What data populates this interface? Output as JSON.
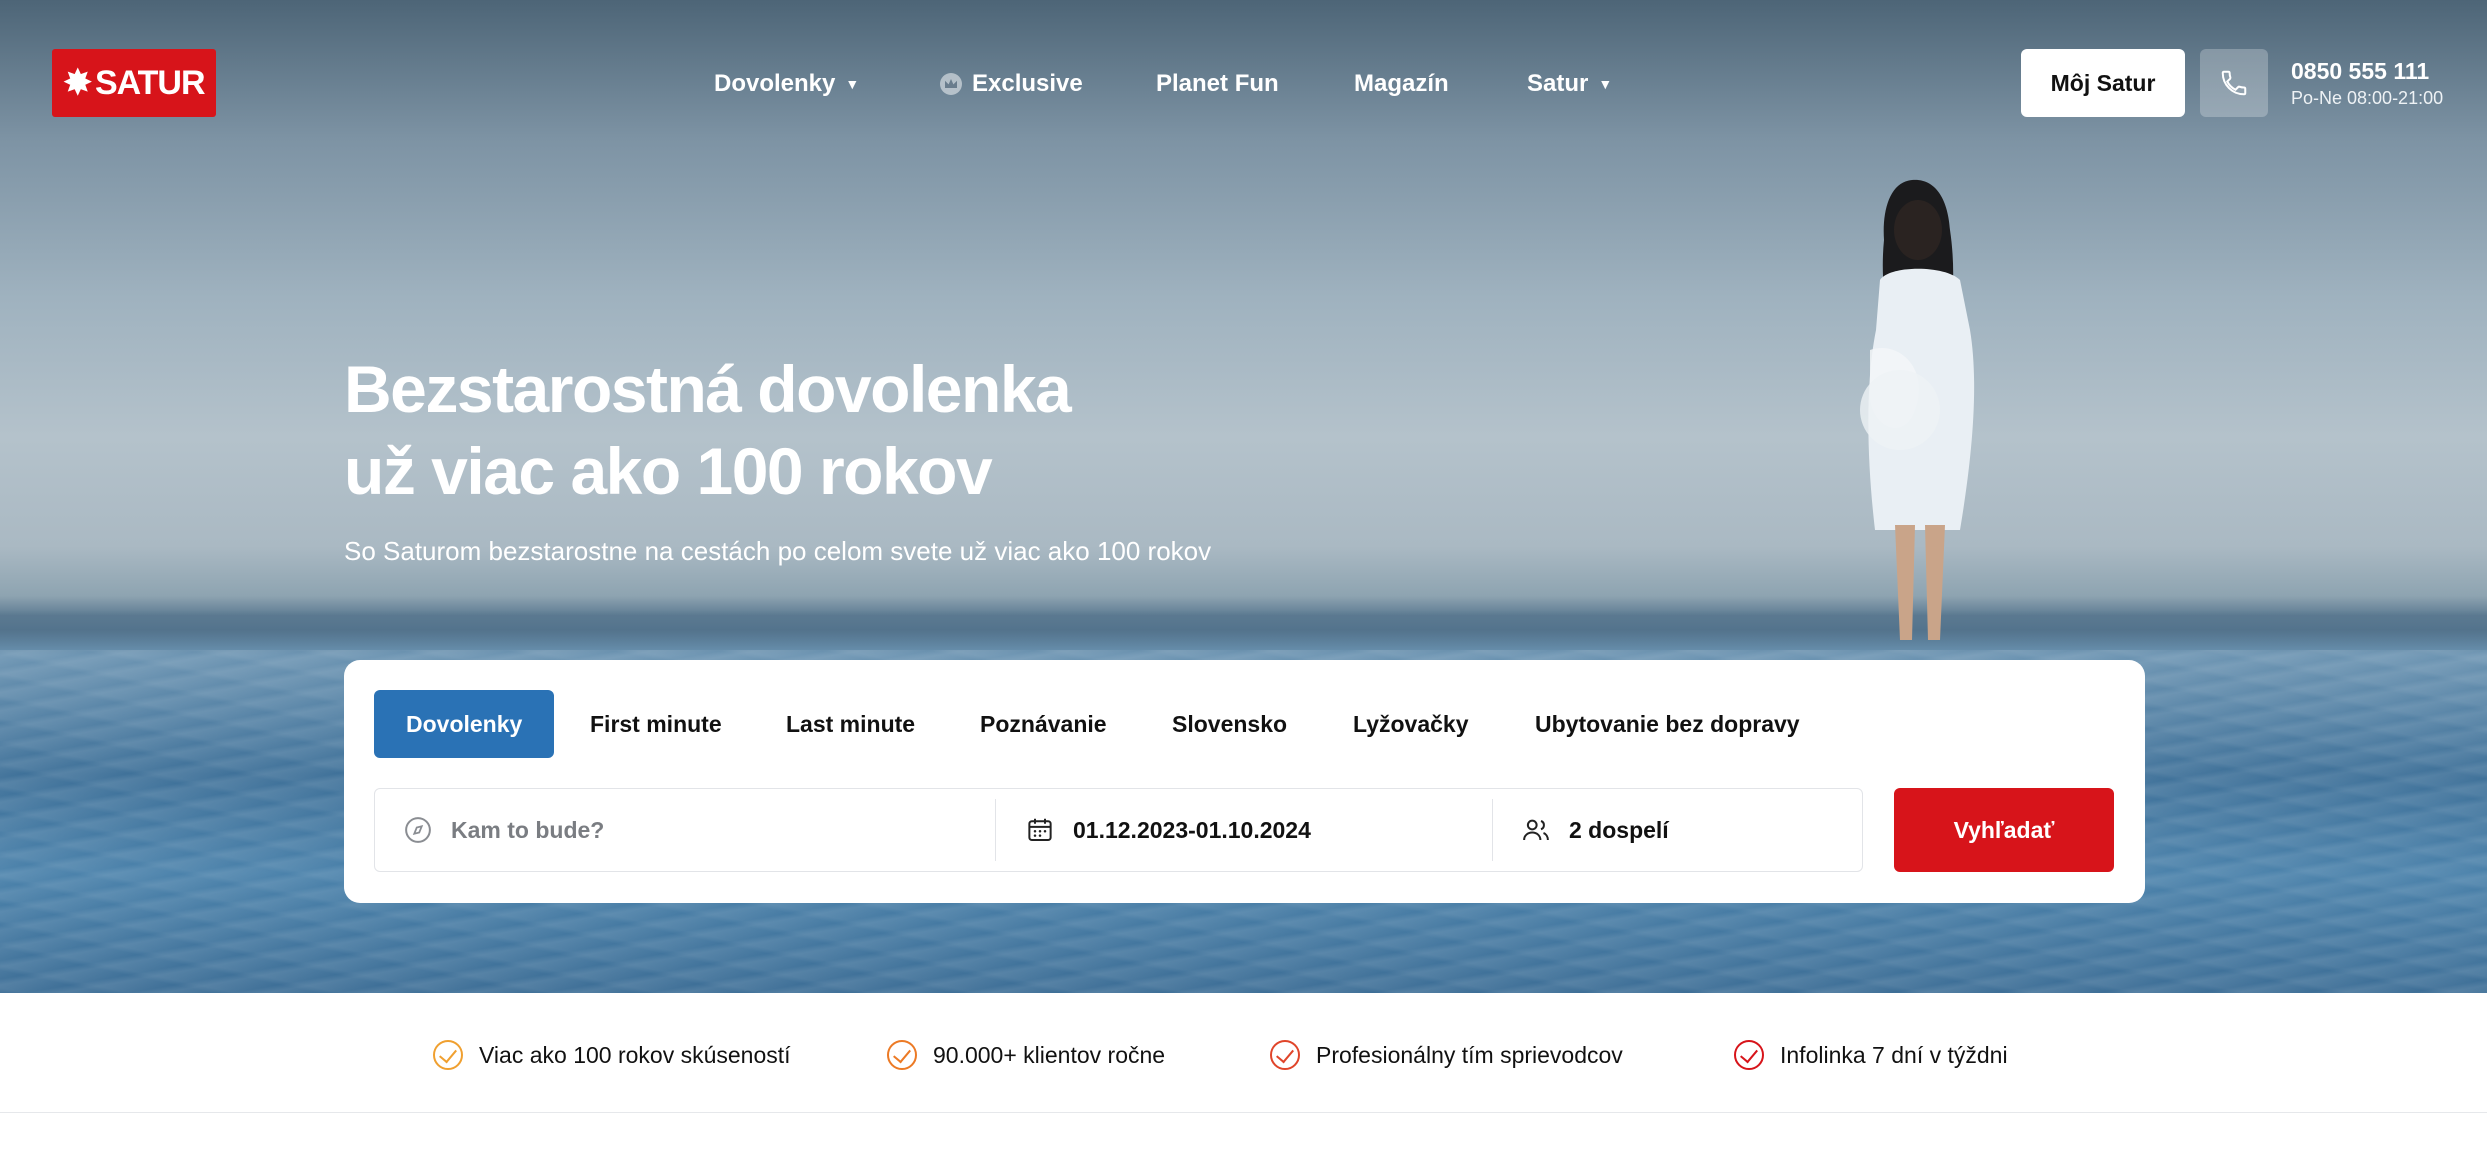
{
  "brand": {
    "logo_text": "SATUR",
    "logo_color": "#d7141a"
  },
  "nav": {
    "items": [
      {
        "label": "Dovolenky",
        "has_dropdown": true
      },
      {
        "label": "Exclusive",
        "icon": "crown-icon"
      },
      {
        "label": "Planet Fun"
      },
      {
        "label": "Magazín"
      },
      {
        "label": "Satur",
        "has_dropdown": true
      }
    ],
    "account_label": "Môj Satur",
    "phone_number": "0850 555 111",
    "phone_hours": "Po-Ne 08:00-21:00"
  },
  "hero": {
    "title_line1": "Bezstarostná dovolenka",
    "title_line2": "už viac ako 100 rokov",
    "subtitle": "So Saturom bezstarostne na cestách po celom svete už viac ako 100 rokov"
  },
  "search": {
    "tabs": [
      {
        "label": "Dovolenky",
        "active": true
      },
      {
        "label": "First minute"
      },
      {
        "label": "Last minute"
      },
      {
        "label": "Poznávanie"
      },
      {
        "label": "Slovensko"
      },
      {
        "label": "Lyžovačky"
      },
      {
        "label": "Ubytovanie bez dopravy"
      }
    ],
    "destination_placeholder": "Kam to bude?",
    "dates": "01.12.2023-01.10.2024",
    "travellers": "2 dospelí",
    "submit_label": "Vyhľadať",
    "active_tab_color": "#2a72b5",
    "submit_color": "#d7141a"
  },
  "usps": [
    {
      "label": "Viac ako 100 rokov skúseností",
      "color": "#f0a030"
    },
    {
      "label": "90.000+ klientov ročne",
      "color": "#ec7a25"
    },
    {
      "label": "Profesionálny tím sprievodcov",
      "color": "#e0452a"
    },
    {
      "label": "Infolinka 7 dní v týždni",
      "color": "#d7141a"
    }
  ]
}
